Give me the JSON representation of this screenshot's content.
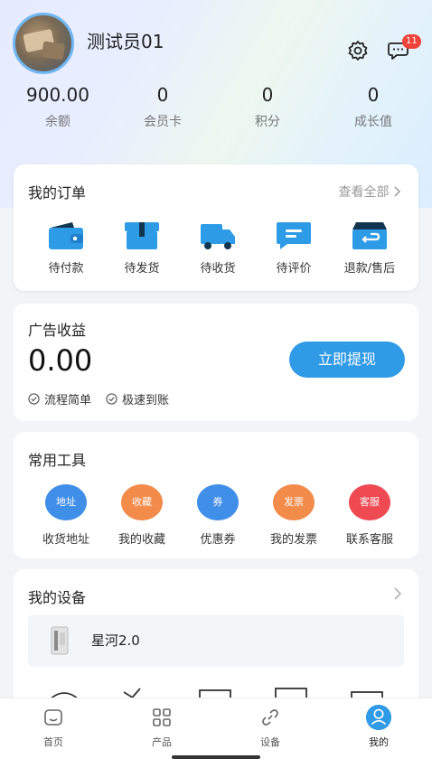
{
  "header": {
    "username": "测试员01",
    "message_badge": "11"
  },
  "stats": [
    {
      "value": "900.00",
      "label": "余额"
    },
    {
      "value": "0",
      "label": "会员卡"
    },
    {
      "value": "0",
      "label": "积分"
    },
    {
      "value": "0",
      "label": "成长值"
    }
  ],
  "orders": {
    "title": "我的订单",
    "view_all": "查看全部",
    "items": [
      {
        "label": "待付款",
        "icon": "wallet-icon"
      },
      {
        "label": "待发货",
        "icon": "box-icon"
      },
      {
        "label": "待收货",
        "icon": "truck-icon"
      },
      {
        "label": "待评价",
        "icon": "comment-icon"
      },
      {
        "label": "退款/售后",
        "icon": "return-icon"
      }
    ]
  },
  "ad": {
    "title": "广告收益",
    "amount": "0.00",
    "button": "立即提现",
    "tags": [
      "流程简单",
      "极速到账"
    ]
  },
  "tools": {
    "title": "常用工具",
    "items": [
      {
        "label": "收货地址",
        "badge": "地址",
        "color": "#3f8ee8"
      },
      {
        "label": "我的收藏",
        "badge": "收藏",
        "color": "#f38b4a"
      },
      {
        "label": "优惠券",
        "badge": "券",
        "color": "#3f8ee8"
      },
      {
        "label": "我的发票",
        "badge": "发票",
        "color": "#f38b4a"
      },
      {
        "label": "联系客服",
        "badge": "客服",
        "color": "#ef4a52"
      }
    ]
  },
  "devices": {
    "title": "我的设备",
    "device_name": "星河2.0"
  },
  "tabbar": [
    {
      "label": "首页",
      "icon": "home-icon"
    },
    {
      "label": "产品",
      "icon": "grid-icon"
    },
    {
      "label": "设备",
      "icon": "link-icon"
    },
    {
      "label": "我的",
      "icon": "user-icon"
    }
  ],
  "colors": {
    "accent": "#2f9ae6",
    "badge": "#f0413a",
    "orange": "#f38b4a",
    "red": "#ef4a52"
  }
}
